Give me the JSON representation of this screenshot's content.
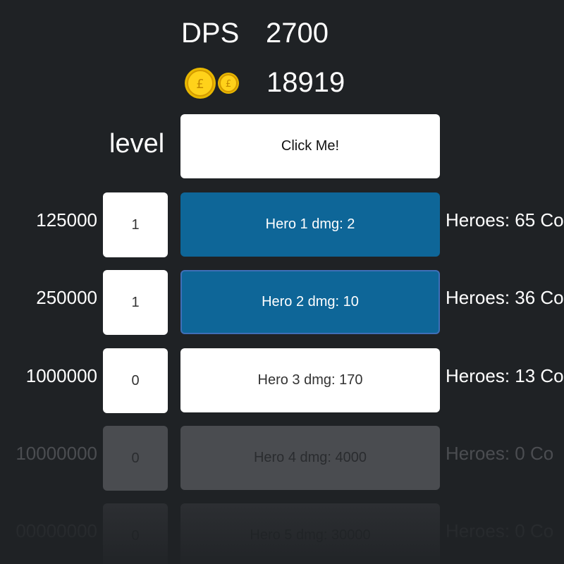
{
  "stats": {
    "dps_label": "DPS",
    "dps_value": "2700",
    "gold_value": "18919",
    "coin_icon": "gold-coin-icon"
  },
  "level_label": "level",
  "click_button": {
    "label": "Click Me!"
  },
  "heroes": [
    {
      "cost": "125000",
      "level": "1",
      "button_label": "Hero 1 dmg: 2",
      "status": "Heroes: 65 Co",
      "state": "affordable"
    },
    {
      "cost": "250000",
      "level": "1",
      "button_label": "Hero 2 dmg: 10",
      "status": "Heroes: 36 Co",
      "state": "affordable-focused"
    },
    {
      "cost": "1000000",
      "level": "0",
      "button_label": "Hero 3 dmg: 170",
      "status": "Heroes: 13 Co",
      "state": "available"
    },
    {
      "cost": "10000000",
      "level": "0",
      "button_label": "Hero 4 dmg: 4000",
      "status": "Heroes: 0 Co",
      "state": "disabled"
    },
    {
      "cost": "00000000",
      "level": "0",
      "button_label": "Hero 5 dmg: 30000",
      "status": "Heroes: 0 Co",
      "state": "disabled-faded"
    }
  ],
  "colors": {
    "background": "#1f2225",
    "hero_button_active": "#0e6698",
    "disabled": "#4a4c50"
  }
}
